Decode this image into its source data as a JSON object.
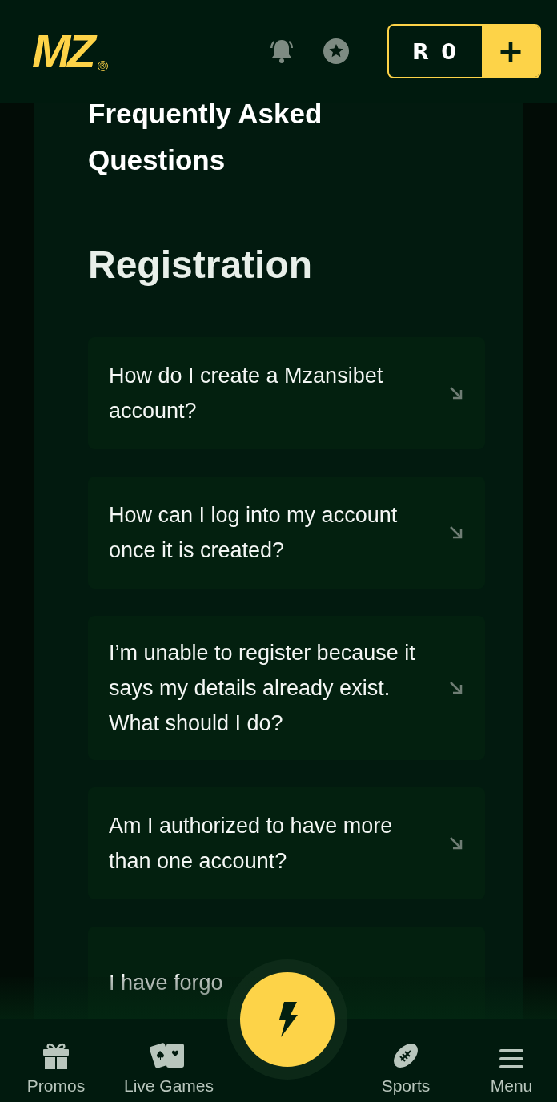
{
  "header": {
    "logo": "MZ",
    "logo_mark": "®",
    "balance": "R 0",
    "deposit_button": "+"
  },
  "faq": {
    "title": "Frequently Asked Questions",
    "section": "Registration",
    "questions": [
      {
        "text": "How do I create a Mzansibet account?"
      },
      {
        "text": "How can I log into my account once it is created?"
      },
      {
        "text": "I’m unable to register because it says my details already exist. What should I do?"
      },
      {
        "text": "Am I authorized to have more than one account?"
      },
      {
        "text": "I have forgo"
      }
    ]
  },
  "bottom_nav": [
    {
      "kind": "gift",
      "label": "Promos"
    },
    {
      "kind": "cards",
      "label": "Live Games"
    },
    {
      "kind": "center"
    },
    {
      "kind": "ball",
      "label": "Sports"
    },
    {
      "kind": "menu",
      "label": "Menu"
    }
  ]
}
